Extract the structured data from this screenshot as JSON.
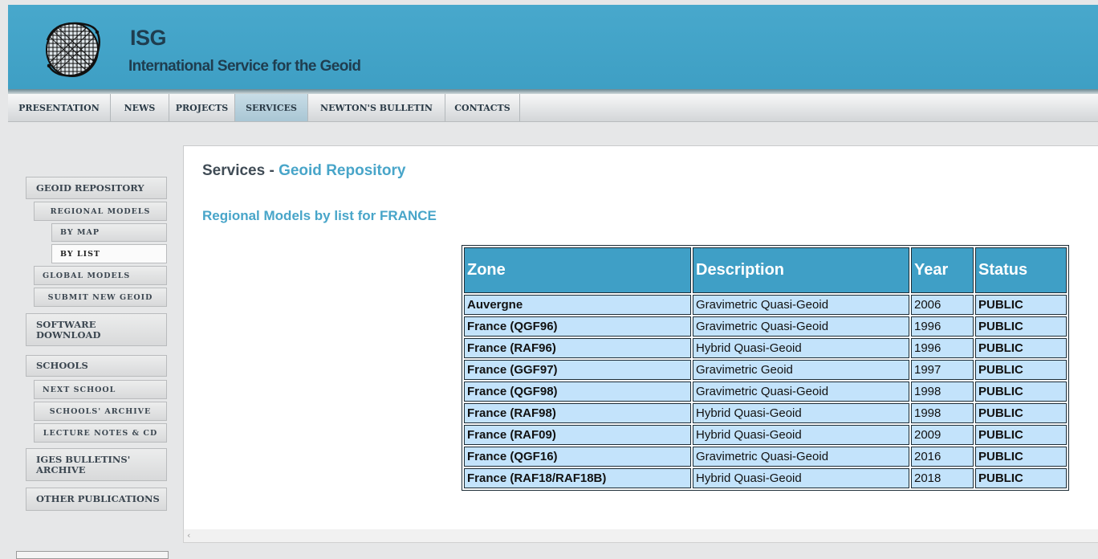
{
  "header": {
    "title": "ISG",
    "subtitle": "International Service for the Geoid"
  },
  "topnav": {
    "tabs": [
      {
        "label": "PRESENTATION"
      },
      {
        "label": "NEWS"
      },
      {
        "label": "PROJECTS"
      },
      {
        "label": "SERVICES",
        "active": true
      },
      {
        "label": "NEWTON'S BULLETIN"
      },
      {
        "label": "CONTACTS"
      }
    ]
  },
  "sidebar": {
    "geoid_repository": "GEOID REPOSITORY",
    "regional_models": "REGIONAL MODELS",
    "by_map": "BY MAP",
    "by_list": "BY LIST",
    "global_models": "GLOBAL MODELS",
    "submit_new_geoid": "SUBMIT NEW GEOID",
    "software_download_1": "SOFTWARE",
    "software_download_2": "DOWNLOAD",
    "schools": "SCHOOLS",
    "next_school": "NEXT SCHOOL",
    "schools_archive": "SCHOOLS' ARCHIVE",
    "lecture_notes": "LECTURE NOTES & CD",
    "iges_bulletins_1": "IGES BULLETINS'",
    "iges_bulletins_2": "ARCHIVE",
    "other_publications": "OTHER PUBLICATIONS"
  },
  "main": {
    "heading_prefix": "Services - ",
    "heading_accent": "Geoid Repository",
    "list_heading": "Regional Models by list for FRANCE",
    "table": {
      "columns": [
        "Zone",
        "Description",
        "Year",
        "Status"
      ],
      "rows": [
        [
          "Auvergne",
          "Gravimetric Quasi-Geoid",
          "2006",
          "PUBLIC"
        ],
        [
          "France (QGF96)",
          "Gravimetric Quasi-Geoid",
          "1996",
          "PUBLIC"
        ],
        [
          "France (RAF96)",
          "Hybrid Quasi-Geoid",
          "1996",
          "PUBLIC"
        ],
        [
          "France (GGF97)",
          "Gravimetric Geoid",
          "1997",
          "PUBLIC"
        ],
        [
          "France (QGF98)",
          "Gravimetric Quasi-Geoid",
          "1998",
          "PUBLIC"
        ],
        [
          "France (RAF98)",
          "Hybrid Quasi-Geoid",
          "1998",
          "PUBLIC"
        ],
        [
          "France (RAF09)",
          "Hybrid Quasi-Geoid",
          "2009",
          "PUBLIC"
        ],
        [
          "France (QGF16)",
          "Gravimetric Quasi-Geoid",
          "2016",
          "PUBLIC"
        ],
        [
          "France (RAF18/RAF18B)",
          "Hybrid Quasi-Geoid",
          "2018",
          "PUBLIC"
        ]
      ]
    }
  },
  "scrollbar": {
    "left_arrow": "‹"
  },
  "colors": {
    "header_bg": "#45a6cb",
    "accent": "#48a5c9",
    "table_header_bg": "#3f9fc6",
    "table_cell_bg": "#c3e3fb",
    "page_bg": "#e6e7e8"
  }
}
